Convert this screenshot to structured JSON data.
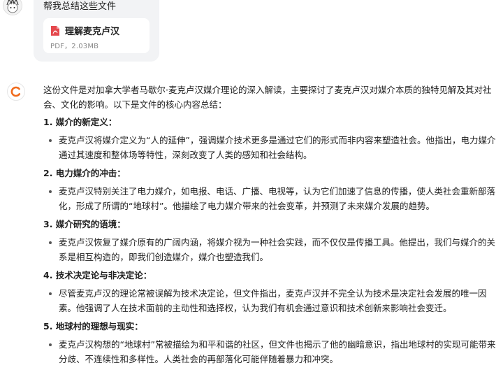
{
  "user": {
    "message": "帮我总结这些文件",
    "file": {
      "name": "理解麦克卢汉",
      "meta": "PDF，2.03MB"
    }
  },
  "answer": {
    "intro": "这份文件是对加拿大学者马歇尔·麦克卢汉媒介理论的深入解读，主要探讨了麦克卢汉对媒介本质的独特见解及其对社会、文化的影响。以下是文件的核心内容总结：",
    "sections": [
      {
        "title": "1. 媒介的新定义：",
        "text": "麦克卢汉将媒介定义为“人的延伸”，强调媒介技术更多是通过它们的形式而非内容来塑造社会。他指出，电力媒介通过其速度和整体场等特性，深刻改变了人类的感知和社会结构。"
      },
      {
        "title": "2. 电力媒介的冲击：",
        "text": "麦克卢汉特别关注了电力媒介，如电报、电话、广播、电视等，认为它们加速了信息的传播，使人类社会重新部落化，形成了所谓的“地球村”。他描绘了电力媒介带来的社会变革，并预测了未来媒介发展的趋势。"
      },
      {
        "title": "3. 媒介研究的语境：",
        "text": "麦克卢汉恢复了媒介原有的广阔内涵，将媒介视为一种社会实践，而不仅仅是传播工具。他提出，我们与媒介的关系是相互构造的，即我们创造媒介，媒介也塑造我们。"
      },
      {
        "title": "4. 技术决定论与非决定论：",
        "text": "尽管麦克卢汉的理论常被误解为技术决定论，但文件指出，麦克卢汉并不完全认为技术是决定社会发展的唯一因素。他强调了人在技术面前的主动性和选择权，认为我们有机会通过意识和技术创新来影响社会变迁。"
      },
      {
        "title": "5. 地球村的理想与现实：",
        "text": "麦克卢汉构想的“地球村”常被描绘为和平和谐的社区，但文件也揭示了他的幽暗意识，指出地球村的实现可能带来分歧、不连续性和多样性。人类社会的再部落化可能伴随着暴力和冲突。"
      }
    ]
  },
  "colors": {
    "pdf_red": "#e5484d",
    "bot_orange": "#f06a1b"
  }
}
